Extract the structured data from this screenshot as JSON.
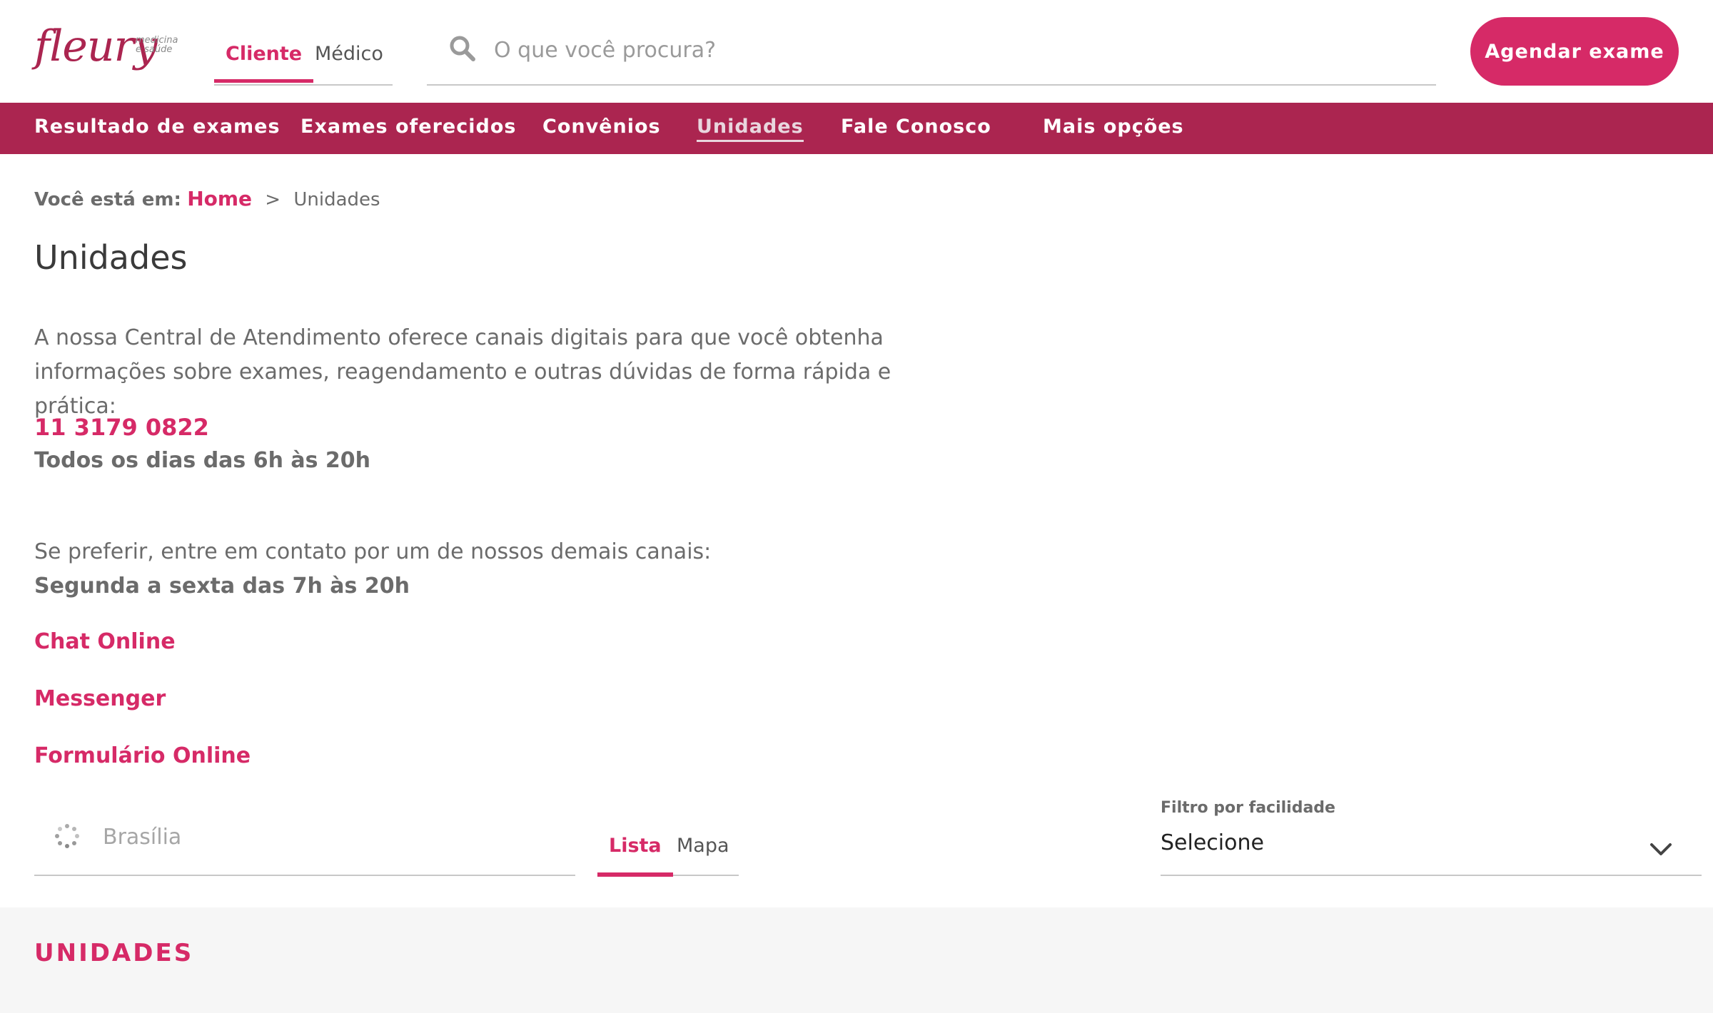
{
  "header": {
    "logo": {
      "word": "fleury",
      "tagline": "medicina e saúde"
    },
    "audience_tabs": [
      {
        "label": "Cliente",
        "active": true
      },
      {
        "label": "Médico",
        "active": false
      }
    ],
    "search": {
      "placeholder": "O que você procura?",
      "value": ""
    },
    "cta_label": "Agendar exame"
  },
  "nav": {
    "items": [
      {
        "label": "Resultado de exames",
        "active": false
      },
      {
        "label": "Exames oferecidos",
        "active": false
      },
      {
        "label": "Convênios",
        "active": false
      },
      {
        "label": "Unidades",
        "active": true
      },
      {
        "label": "Fale Conosco",
        "active": false
      },
      {
        "label": "Mais opções",
        "active": false
      }
    ]
  },
  "breadcrumb": {
    "prefix": "Você está em:",
    "home": "Home",
    "separator": ">",
    "current": "Unidades"
  },
  "page": {
    "title": "Unidades",
    "intro": "A nossa Central de Atendimento oferece canais digitais para que você obtenha informações sobre exames, reagendamento e outras dúvidas de forma rápida e prática:",
    "phone": "11 3179 0822",
    "phone_hours": "Todos os dias das 6h às 20h",
    "other_channels_text": "Se preferir, entre em contato por um de nossos demais canais:",
    "other_channels_hours": "Segunda a sexta das 7h às 20h",
    "channels": [
      {
        "label": "Chat Online"
      },
      {
        "label": "Messenger"
      },
      {
        "label": "Formulário Online"
      }
    ]
  },
  "filters": {
    "location": {
      "placeholder": "Brasília",
      "value": ""
    },
    "view_tabs": [
      {
        "label": "Lista",
        "active": true
      },
      {
        "label": "Mapa",
        "active": false
      }
    ],
    "facility": {
      "label": "Filtro por facilidade",
      "selected": "Selecione"
    }
  },
  "units_section": {
    "heading": "UNIDADES"
  },
  "colors": {
    "brand_pink": "#d62a67",
    "nav_wine": "#ab2550",
    "section_bg": "#f6f6f6"
  },
  "icons": [
    "search-icon",
    "spinner-icon",
    "chevron-down-icon"
  ]
}
